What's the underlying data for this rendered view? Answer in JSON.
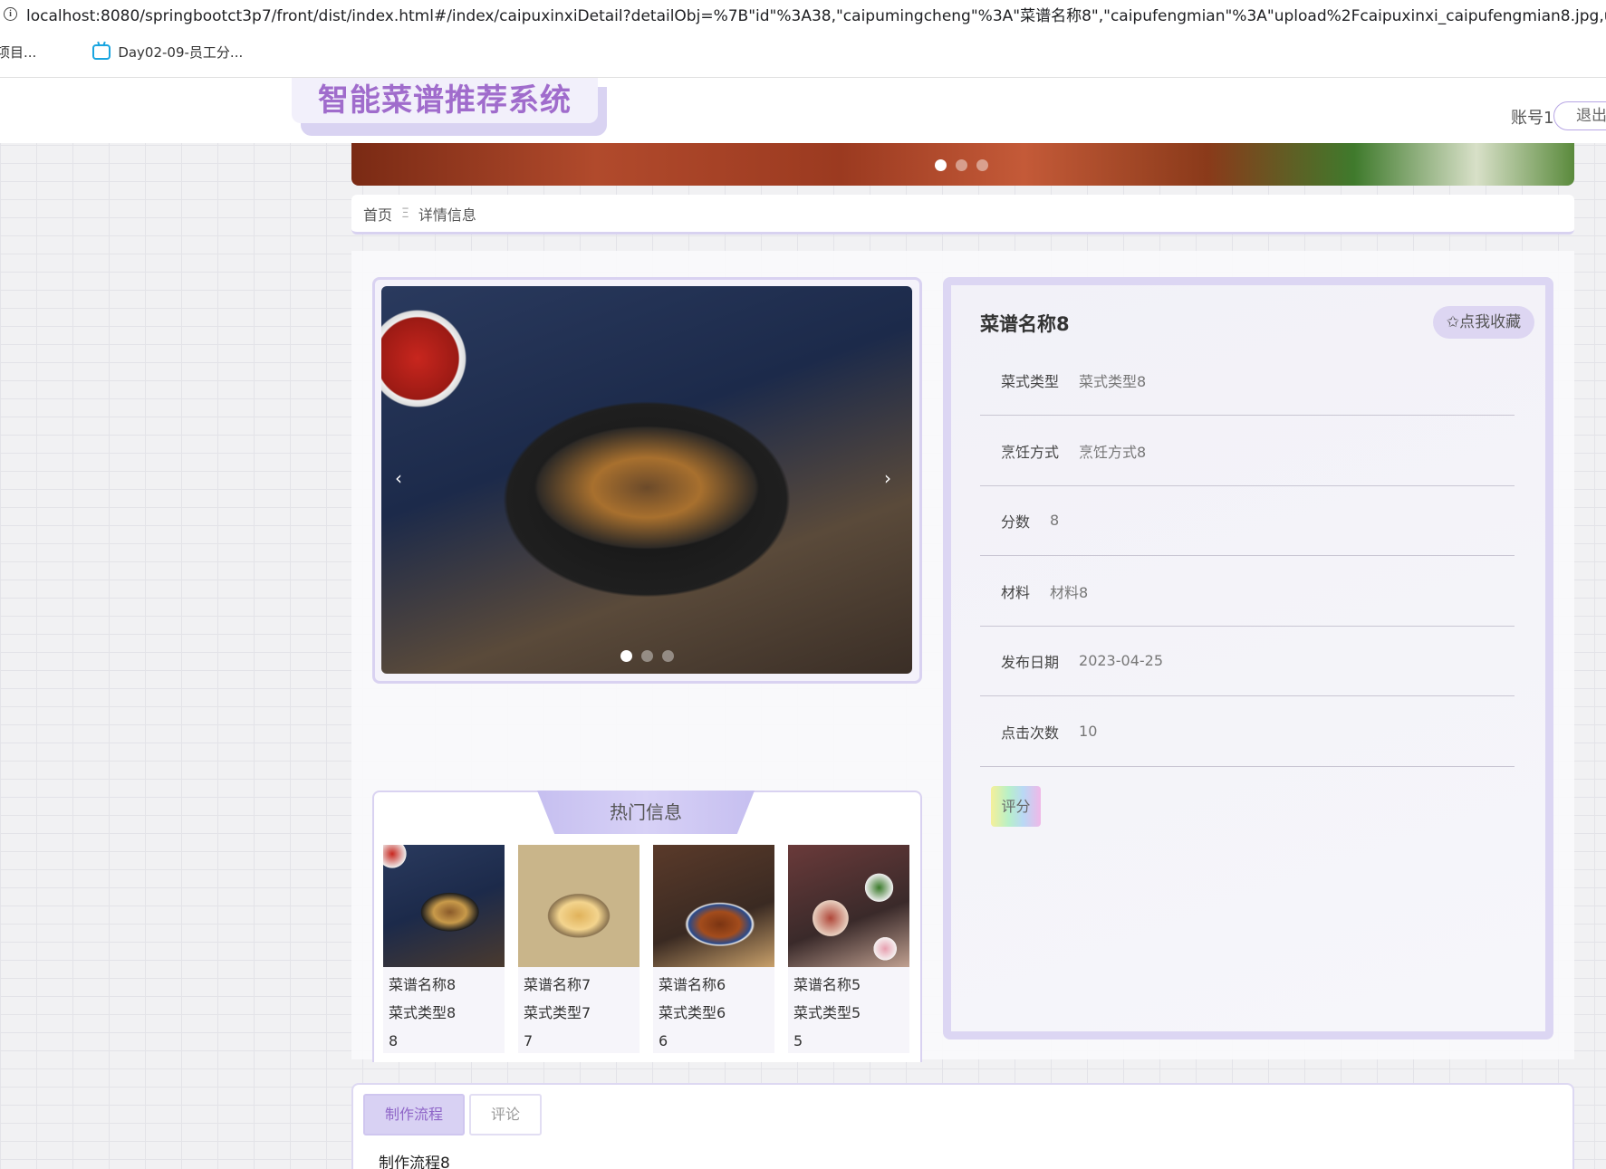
{
  "browser": {
    "url": "localhost:8080/springbootct3p7/front/dist/index.html#/index/caipuxinxiDetail?detailObj=%7B\"id\"%3A38,\"caipumingcheng\"%3A\"菜谱名称8\",\"caipufengmian\"%3A\"upload%2Fcaipuxinxi_caipufengmian8.jpg,upl",
    "bookmarks": [
      "项目...",
      "Day02-09-员工分..."
    ]
  },
  "header": {
    "site_title": "智能菜谱推荐系统",
    "account_label": "账号1",
    "logout_label": "退出"
  },
  "breadcrumb": {
    "home": "首页",
    "separator": "Ξ",
    "current": "详情信息"
  },
  "gallery": {
    "prev_icon": "‹",
    "next_icon": "›",
    "slide_count": 3,
    "active_slide": 1
  },
  "banner": {
    "slide_count": 3,
    "active_slide": 1
  },
  "detail": {
    "title": "菜谱名称8",
    "favorite_label": "✩点我收藏",
    "fields": [
      {
        "label": "菜式类型",
        "value": "菜式类型8"
      },
      {
        "label": "烹饪方式",
        "value": "烹饪方式8"
      },
      {
        "label": "分数",
        "value": "8"
      },
      {
        "label": "材料",
        "value": "材料8"
      },
      {
        "label": "发布日期",
        "value": "2023-04-25"
      },
      {
        "label": "点击次数",
        "value": "10"
      }
    ],
    "rate_label": "评分"
  },
  "hot": {
    "title": "热门信息",
    "items": [
      {
        "name": "菜谱名称8",
        "type": "菜式类型8",
        "score": "8"
      },
      {
        "name": "菜谱名称7",
        "type": "菜式类型7",
        "score": "7"
      },
      {
        "name": "菜谱名称6",
        "type": "菜式类型6",
        "score": "6"
      },
      {
        "name": "菜谱名称5",
        "type": "菜式类型5",
        "score": "5"
      }
    ]
  },
  "tabs": {
    "items": [
      "制作流程",
      "评论"
    ],
    "active_content": "制作流程8"
  },
  "colors": {
    "accent": "#a06ccc",
    "panel_border": "#dcd6f3",
    "tab_active_bg": "#d8d1f3"
  }
}
